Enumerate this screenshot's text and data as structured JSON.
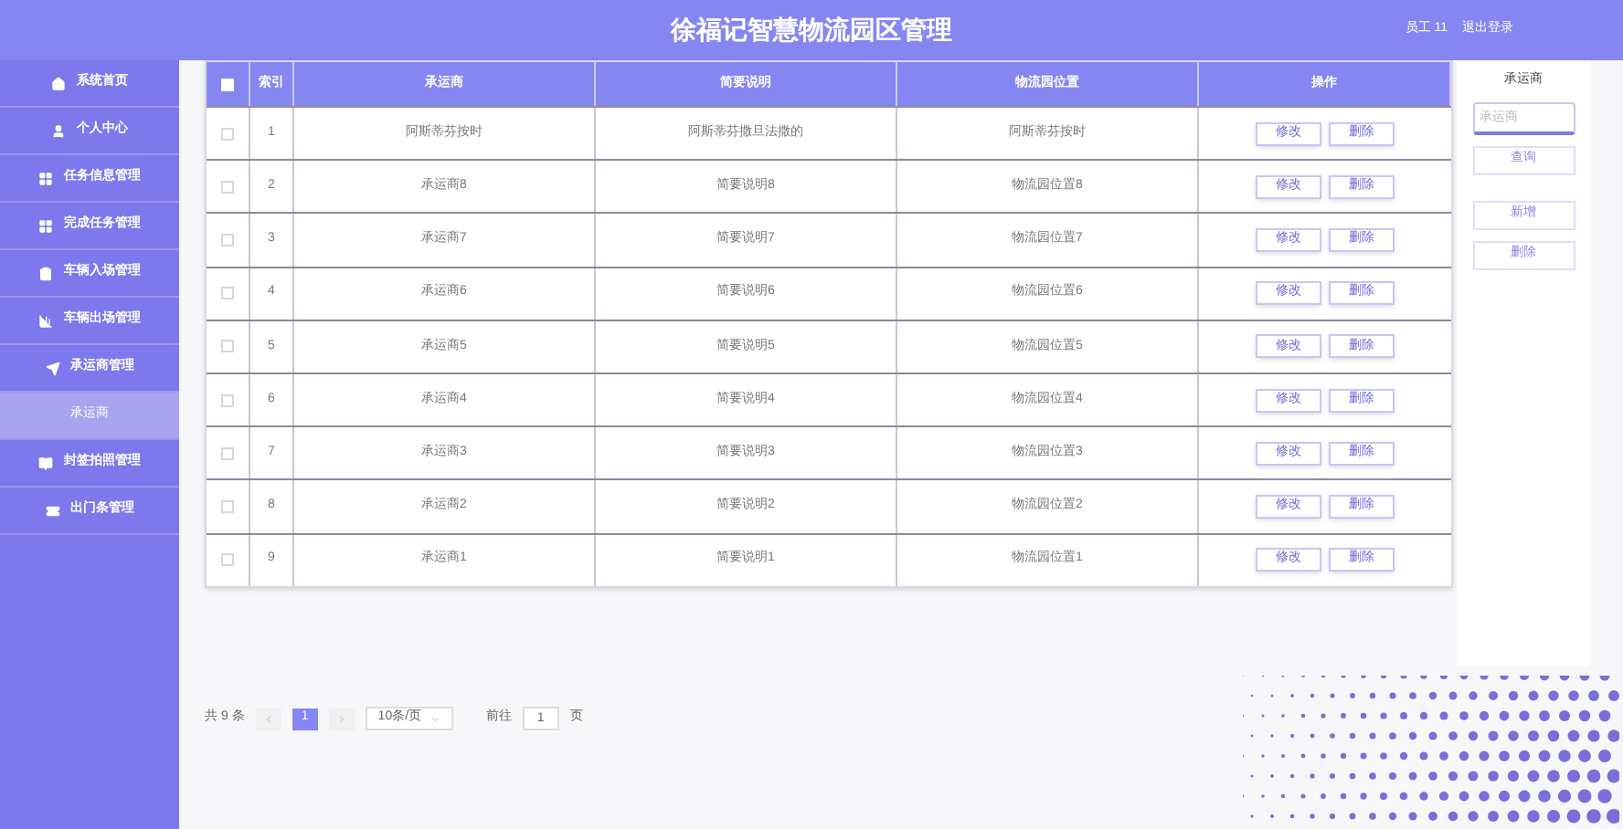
{
  "header": {
    "title": "徐福记智慧物流园区管理",
    "user": "员工 11",
    "logout": "退出登录"
  },
  "sidebar": {
    "items": [
      {
        "label": "系统首页",
        "kind": "item",
        "selected": false
      },
      {
        "label": "个人中心",
        "kind": "item",
        "selected": false
      },
      {
        "label": "任务信息管理",
        "kind": "item",
        "selected": false
      },
      {
        "label": "完成任务管理",
        "kind": "item",
        "selected": false
      },
      {
        "label": "车辆入场管理",
        "kind": "item",
        "selected": false
      },
      {
        "label": "车辆出场管理",
        "kind": "item",
        "selected": false
      },
      {
        "label": "承运商管理",
        "kind": "item",
        "selected": false
      },
      {
        "label": "承运商",
        "kind": "sub",
        "selected": true
      },
      {
        "label": "封签拍照管理",
        "kind": "item",
        "selected": false
      },
      {
        "label": "出门条管理",
        "kind": "item",
        "selected": false
      }
    ]
  },
  "table": {
    "header_checked": false,
    "columns": [
      "索引",
      "承运商",
      "简要说明",
      "物流园位置",
      "操作"
    ],
    "rows": [
      {
        "checked": false,
        "cells": [
          "1",
          "阿斯蒂芬按时",
          "阿斯蒂芬撒旦法撒的",
          "阿斯蒂芬按时"
        ],
        "actions": [
          "修改",
          "删除"
        ]
      },
      {
        "checked": false,
        "cells": [
          "2",
          "承运商8",
          "简要说明8",
          "物流园位置8"
        ],
        "actions": [
          "修改",
          "删除"
        ]
      },
      {
        "checked": false,
        "cells": [
          "3",
          "承运商7",
          "简要说明7",
          "物流园位置7"
        ],
        "actions": [
          "修改",
          "删除"
        ]
      },
      {
        "checked": false,
        "cells": [
          "4",
          "承运商6",
          "简要说明6",
          "物流园位置6"
        ],
        "actions": [
          "修改",
          "删除"
        ]
      },
      {
        "checked": false,
        "cells": [
          "5",
          "承运商5",
          "简要说明5",
          "物流园位置5"
        ],
        "actions": [
          "修改",
          "删除"
        ]
      },
      {
        "checked": false,
        "cells": [
          "6",
          "承运商4",
          "简要说明4",
          "物流园位置4"
        ],
        "actions": [
          "修改",
          "删除"
        ]
      },
      {
        "checked": false,
        "cells": [
          "7",
          "承运商3",
          "简要说明3",
          "物流园位置3"
        ],
        "actions": [
          "修改",
          "删除"
        ]
      },
      {
        "checked": false,
        "cells": [
          "8",
          "承运商2",
          "简要说明2",
          "物流园位置2"
        ],
        "actions": [
          "修改",
          "删除"
        ]
      },
      {
        "checked": false,
        "cells": [
          "9",
          "承运商1",
          "简要说明1",
          "物流园位置1"
        ],
        "actions": [
          "修改",
          "删除"
        ]
      }
    ]
  },
  "search_panel": {
    "title": "承运商",
    "placeholder": "承运商",
    "buttons": [
      "查询",
      "新增",
      "删除"
    ]
  },
  "pagination": {
    "total": "共 9 条",
    "pages": [
      {
        "label": "1",
        "selected": true
      }
    ],
    "page_size": "10条/页",
    "goto": "前往",
    "goto_value": "1",
    "page_unit": "页"
  }
}
